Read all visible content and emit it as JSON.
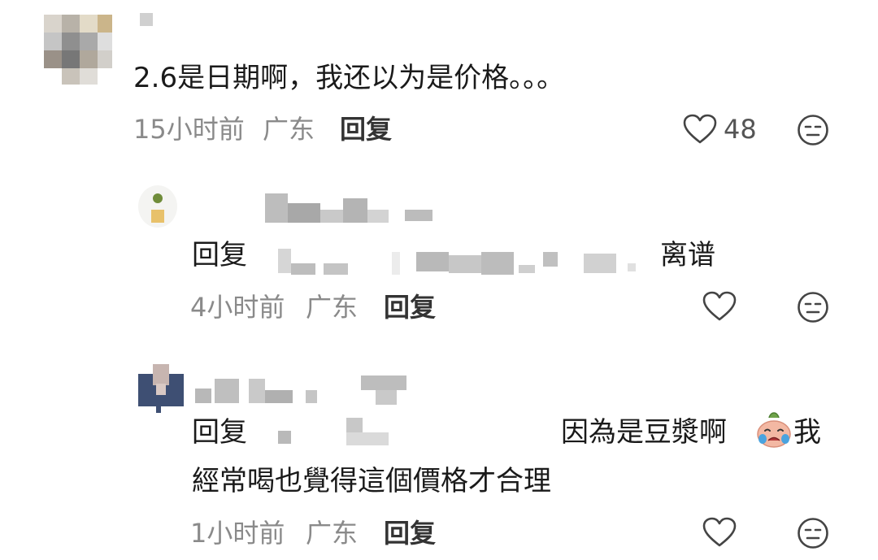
{
  "comments": [
    {
      "text": "2.6是日期啊，我还以为是价格。。。",
      "time": "15小时前",
      "location": "广东",
      "reply_label": "回复",
      "like_count": "48"
    },
    {
      "reply_prefix": "回复",
      "text": "离谱",
      "time": "4小时前",
      "location": "广东",
      "reply_label": "回复"
    },
    {
      "reply_prefix": "回复",
      "text_line1": "因為是豆漿啊",
      "text_line1_tail": "我",
      "text_line2": "經常喝也覺得這個價格才合理",
      "time": "1小时前",
      "location": "广东",
      "reply_label": "回复"
    }
  ],
  "icons": {
    "like": "heart-outline-icon",
    "dislike": "unamused-face-icon",
    "emoji": "crying-face-emoji"
  },
  "colors": {
    "text": "#1a1a1a",
    "meta": "#8a8a8a",
    "icon": "#444444"
  }
}
